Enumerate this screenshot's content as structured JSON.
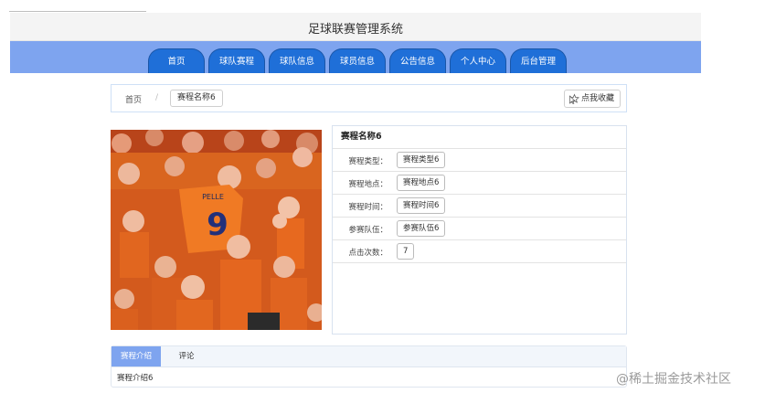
{
  "header": {
    "title": "足球联赛管理系统"
  },
  "nav": {
    "items": [
      {
        "label": "首页"
      },
      {
        "label": "球队赛程"
      },
      {
        "label": "球队信息"
      },
      {
        "label": "球员信息"
      },
      {
        "label": "公告信息"
      },
      {
        "label": "个人中心"
      },
      {
        "label": "后台管理"
      }
    ],
    "colors": {
      "bar": "#7ea4ef",
      "tab": "#1f6fd8"
    }
  },
  "breadcrumb": {
    "home": "首页",
    "separator": "/",
    "current": "赛程名称6"
  },
  "favorite": {
    "label": "点我收藏",
    "icon": "star-cursor-icon"
  },
  "photo": {
    "jersey_name": "PELLE",
    "jersey_number": "9"
  },
  "detail": {
    "title": "赛程名称6",
    "fields": [
      {
        "label": "赛程类型：",
        "value": "赛程类型6"
      },
      {
        "label": "赛程地点：",
        "value": "赛程地点6"
      },
      {
        "label": "赛程时间：",
        "value": "赛程时间6"
      },
      {
        "label": "参赛队伍：",
        "value": "参赛队伍6"
      },
      {
        "label": "点击次数：",
        "value": "7"
      }
    ]
  },
  "tabs": {
    "items": [
      {
        "label": "赛程介绍"
      },
      {
        "label": "评论"
      }
    ],
    "active_content": "赛程介绍6"
  },
  "watermark": "@稀土掘金技术社区"
}
